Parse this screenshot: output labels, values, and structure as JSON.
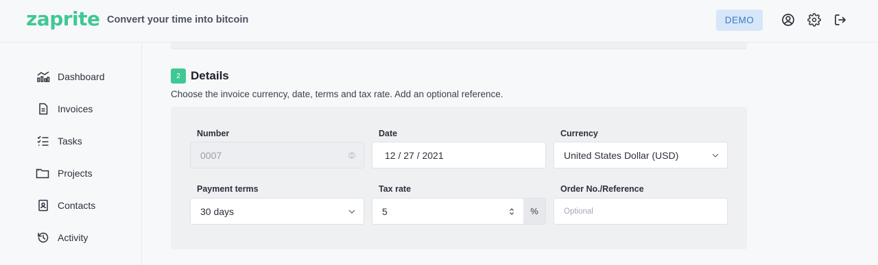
{
  "header": {
    "logo": "zaprite",
    "tagline": "Convert your time into bitcoin",
    "demo_label": "DEMO",
    "icons": [
      "account-icon",
      "settings-gear-icon",
      "logout-icon"
    ]
  },
  "sidebar": {
    "items": [
      {
        "label": "Dashboard",
        "icon": "chart-icon"
      },
      {
        "label": "Invoices",
        "icon": "document-icon"
      },
      {
        "label": "Tasks",
        "icon": "checklist-icon"
      },
      {
        "label": "Projects",
        "icon": "folder-icon"
      },
      {
        "label": "Contacts",
        "icon": "contact-card-icon"
      },
      {
        "label": "Activity",
        "icon": "history-icon"
      }
    ]
  },
  "details": {
    "step": "2",
    "title": "Details",
    "description": "Choose the invoice currency, date, terms and tax rate. Add an optional reference.",
    "number": {
      "label": "Number",
      "value": "0007"
    },
    "date": {
      "label": "Date",
      "value": "12 / 27 / 2021"
    },
    "currency": {
      "label": "Currency",
      "value": "United States Dollar (USD)"
    },
    "payment_terms": {
      "label": "Payment terms",
      "value": "30 days"
    },
    "tax_rate": {
      "label": "Tax rate",
      "value": "5",
      "unit": "%"
    },
    "reference": {
      "label": "Order No./Reference",
      "placeholder": "Optional"
    }
  },
  "colors": {
    "brand": "#3fc894",
    "demo_bg": "#d7e6f8",
    "demo_text": "#3a78c9"
  }
}
